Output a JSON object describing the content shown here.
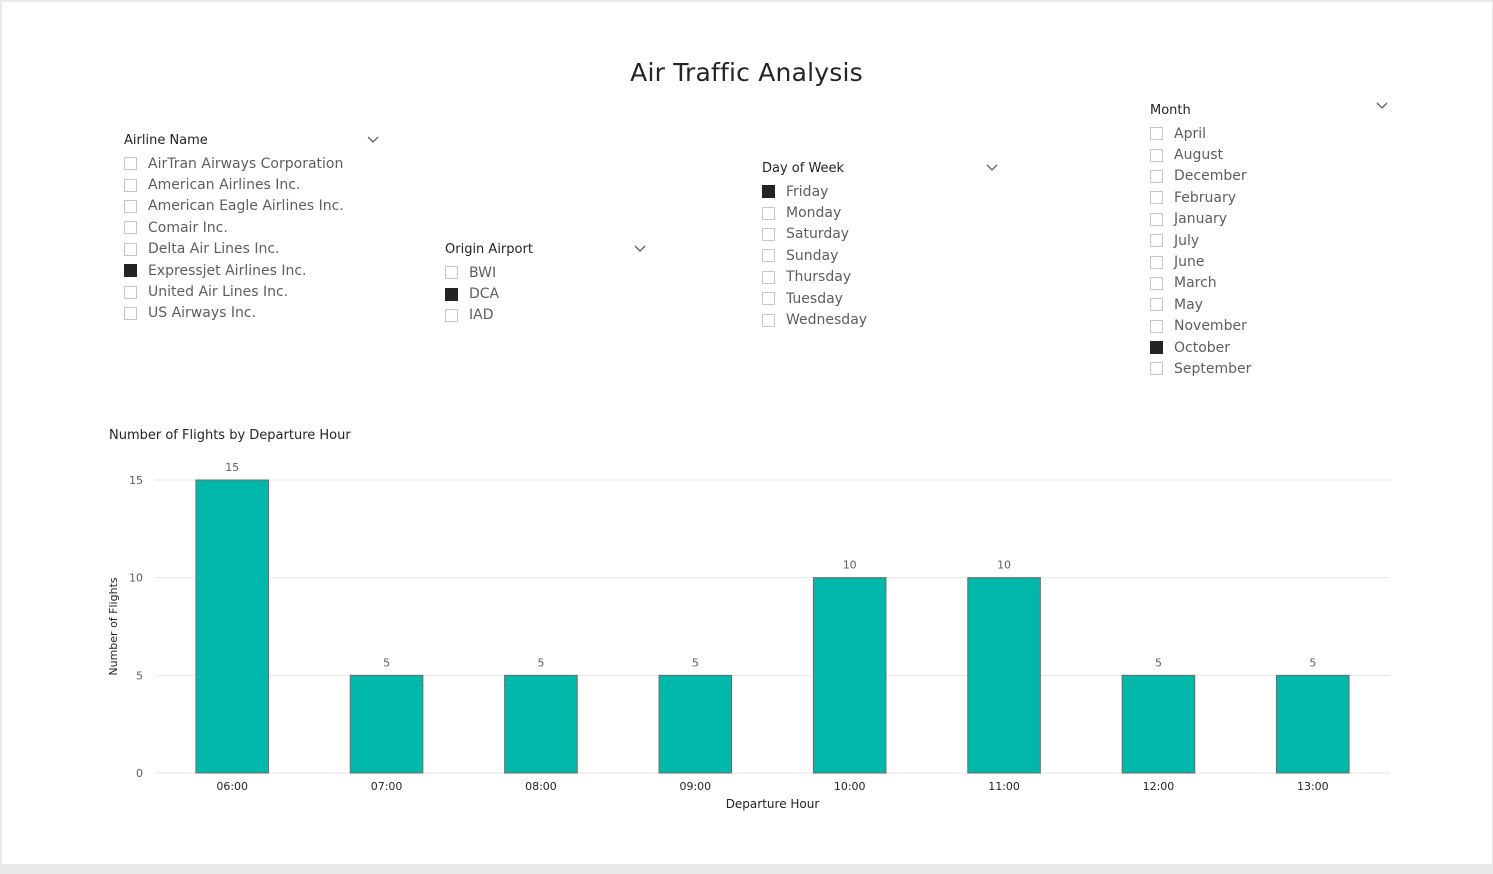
{
  "report": {
    "title": "Air Traffic Analysis"
  },
  "slicers": {
    "airline": {
      "title": "Airline Name",
      "items": [
        {
          "label": "AirTran Airways Corporation",
          "checked": false
        },
        {
          "label": "American Airlines Inc.",
          "checked": false
        },
        {
          "label": "American Eagle Airlines Inc.",
          "checked": false
        },
        {
          "label": "Comair Inc.",
          "checked": false
        },
        {
          "label": "Delta Air Lines Inc.",
          "checked": false
        },
        {
          "label": "Expressjet Airlines Inc.",
          "checked": true
        },
        {
          "label": "United Air Lines Inc.",
          "checked": false
        },
        {
          "label": "US Airways Inc.",
          "checked": false
        }
      ]
    },
    "origin": {
      "title": "Origin Airport",
      "items": [
        {
          "label": "BWI",
          "checked": false
        },
        {
          "label": "DCA",
          "checked": true
        },
        {
          "label": "IAD",
          "checked": false
        }
      ]
    },
    "day": {
      "title": "Day of Week",
      "items": [
        {
          "label": "Friday",
          "checked": true
        },
        {
          "label": "Monday",
          "checked": false
        },
        {
          "label": "Saturday",
          "checked": false
        },
        {
          "label": "Sunday",
          "checked": false
        },
        {
          "label": "Thursday",
          "checked": false
        },
        {
          "label": "Tuesday",
          "checked": false
        },
        {
          "label": "Wednesday",
          "checked": false
        }
      ]
    },
    "month": {
      "title": "Month",
      "items": [
        {
          "label": "April",
          "checked": false
        },
        {
          "label": "August",
          "checked": false
        },
        {
          "label": "December",
          "checked": false
        },
        {
          "label": "February",
          "checked": false
        },
        {
          "label": "January",
          "checked": false
        },
        {
          "label": "July",
          "checked": false
        },
        {
          "label": "June",
          "checked": false
        },
        {
          "label": "March",
          "checked": false
        },
        {
          "label": "May",
          "checked": false
        },
        {
          "label": "November",
          "checked": false
        },
        {
          "label": "October",
          "checked": true
        },
        {
          "label": "September",
          "checked": false
        }
      ]
    }
  },
  "colors": {
    "bar": "#01b8aa",
    "bar_stroke": "#6a6a6a",
    "gridline": "#e6e6e6",
    "checked": "#252423"
  },
  "icons": {
    "slicer_dropdown": "chevron-down-icon"
  },
  "chart_data": {
    "type": "bar",
    "title": "Number of Flights by Departure Hour",
    "xlabel": "Departure Hour",
    "ylabel": "Number of Flights",
    "categories": [
      "06:00",
      "07:00",
      "08:00",
      "09:00",
      "10:00",
      "11:00",
      "12:00",
      "13:00"
    ],
    "values": [
      15,
      5,
      5,
      5,
      10,
      10,
      5,
      5
    ],
    "ylim": [
      0,
      15
    ],
    "yticks": [
      0,
      5,
      10,
      15
    ],
    "data_labels": true,
    "grid": true,
    "legend": "none"
  }
}
